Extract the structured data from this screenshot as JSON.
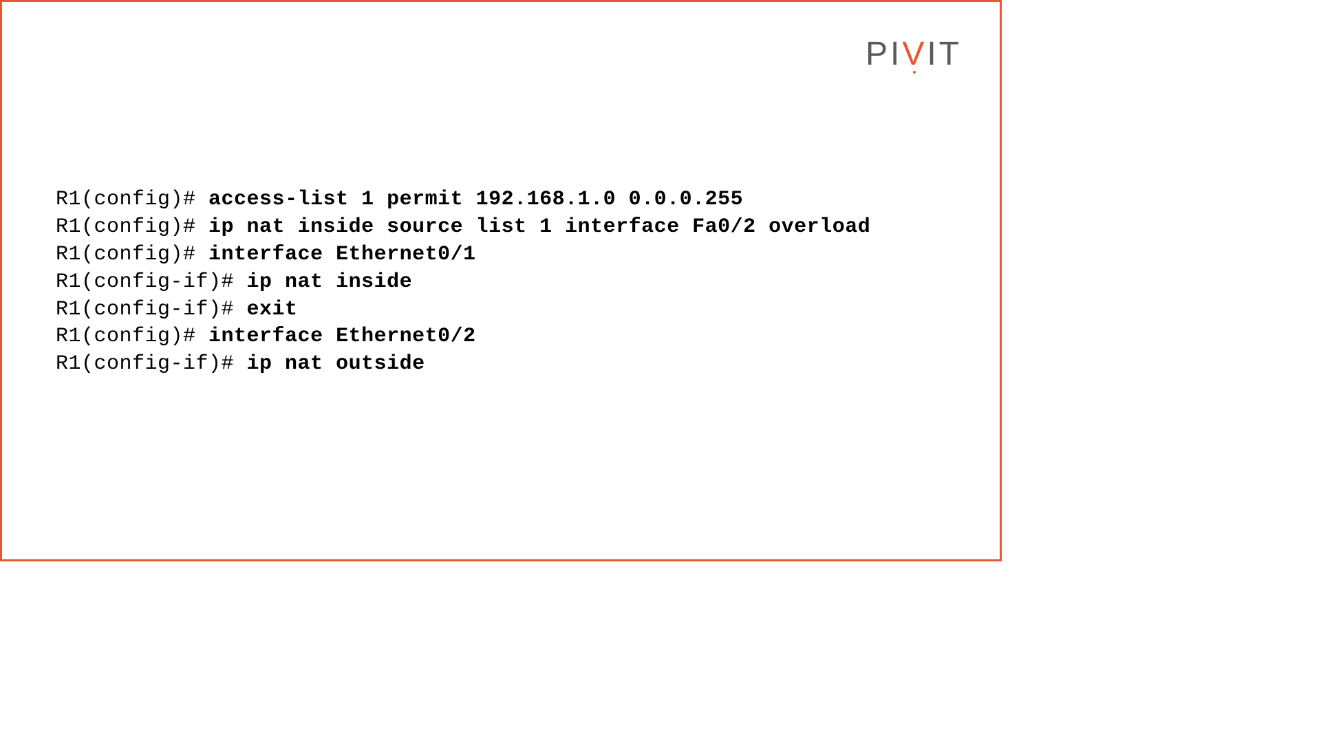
{
  "logo": {
    "part1": "PI",
    "accent": "V",
    "part2": "IT"
  },
  "terminal": {
    "lines": [
      {
        "prompt": "R1(config)# ",
        "command": "access-list 1 permit 192.168.1.0 0.0.0.255"
      },
      {
        "prompt": "R1(config)# ",
        "command": "ip nat inside source list 1 interface Fa0/2 overload"
      },
      {
        "prompt": "R1(config)# ",
        "command": "interface Ethernet0/1"
      },
      {
        "prompt": "R1(config-if)# ",
        "command": "ip nat inside"
      },
      {
        "prompt": "R1(config-if)# ",
        "command": "exit"
      },
      {
        "prompt": "R1(config)# ",
        "command": "interface Ethernet0/2"
      },
      {
        "prompt": "R1(config-if)# ",
        "command": "ip nat outside"
      }
    ]
  }
}
